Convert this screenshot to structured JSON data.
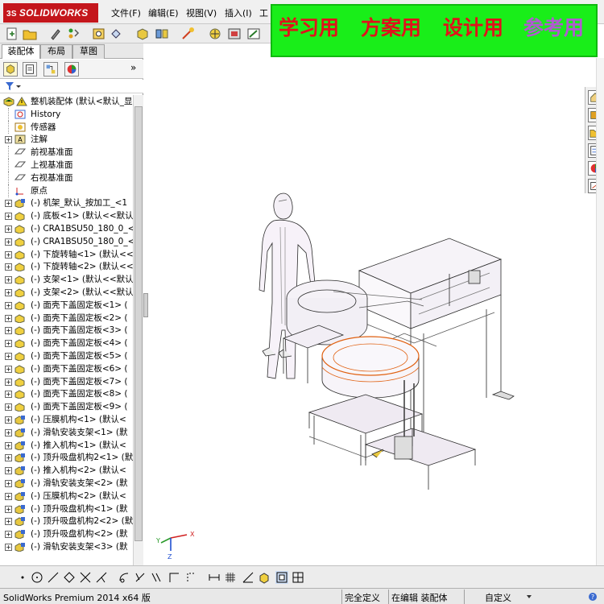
{
  "app": {
    "logo_text": "SOLIDWORKS",
    "logo_prefix": "3S"
  },
  "menu": {
    "items": [
      "文件(F)",
      "编辑(E)",
      "视图(V)",
      "插入(I)",
      "工"
    ]
  },
  "banner": {
    "words": [
      {
        "text": "学习用",
        "color": "#e0121b"
      },
      {
        "text": "方案用",
        "color": "#e0121b"
      },
      {
        "text": "设计用",
        "color": "#e0121b"
      },
      {
        "text": "参考用",
        "color": "#b05ad0"
      }
    ]
  },
  "panel": {
    "tabs": [
      "装配体",
      "布局",
      "草图"
    ],
    "active_tab": 0
  },
  "tree": {
    "root": "整机装配体 (默认<默认_显",
    "items": [
      {
        "label": "History",
        "icon": "history-icon",
        "expand": false
      },
      {
        "label": "传感器",
        "icon": "sensor-icon",
        "expand": false
      },
      {
        "label": "注解",
        "icon": "annotation-icon",
        "expand": true
      },
      {
        "label": "前视基准面",
        "icon": "plane-icon",
        "expand": false
      },
      {
        "label": "上视基准面",
        "icon": "plane-icon",
        "expand": false
      },
      {
        "label": "右视基准面",
        "icon": "plane-icon",
        "expand": false
      },
      {
        "label": "原点",
        "icon": "origin-icon",
        "expand": false
      },
      {
        "label": "(-) 机架_默认_按加工_<1",
        "icon": "subassembly-icon",
        "expand": true
      },
      {
        "label": "(-) 底板<1> (默认<<默认",
        "icon": "part-icon",
        "expand": true
      },
      {
        "label": "(-) CRA1BSU50_180_0_<1>",
        "icon": "part-icon",
        "expand": true
      },
      {
        "label": "(-) CRA1BSU50_180_0_<2>",
        "icon": "part-icon",
        "expand": true
      },
      {
        "label": "(-) 下旋转轴<1> (默认<<",
        "icon": "part-icon",
        "expand": true
      },
      {
        "label": "(-) 下旋转轴<2> (默认<<",
        "icon": "part-icon",
        "expand": true
      },
      {
        "label": "(-) 支架<1> (默认<<默认",
        "icon": "part-icon",
        "expand": true
      },
      {
        "label": "(-) 支架<2> (默认<<默认",
        "icon": "part-icon",
        "expand": true
      },
      {
        "label": "(-) 面壳下盖固定板<1> (",
        "icon": "part-icon",
        "expand": true
      },
      {
        "label": "(-) 面壳下盖固定板<2> (",
        "icon": "part-icon",
        "expand": true
      },
      {
        "label": "(-) 面壳下盖固定板<3> (",
        "icon": "part-icon",
        "expand": true
      },
      {
        "label": "(-) 面壳下盖固定板<4> (",
        "icon": "part-icon",
        "expand": true
      },
      {
        "label": "(-) 面壳下盖固定板<5> (",
        "icon": "part-icon",
        "expand": true
      },
      {
        "label": "(-) 面壳下盖固定板<6> (",
        "icon": "part-icon",
        "expand": true
      },
      {
        "label": "(-) 面壳下盖固定板<7> (",
        "icon": "part-icon",
        "expand": true
      },
      {
        "label": "(-) 面壳下盖固定板<8> (",
        "icon": "part-icon",
        "expand": true
      },
      {
        "label": "(-) 面壳下盖固定板<9> (",
        "icon": "part-icon",
        "expand": true
      },
      {
        "label": "(-) 压膜机构<1> (默认<",
        "icon": "subassembly-icon",
        "expand": true
      },
      {
        "label": "(-) 滑轨安装支架<1> (默",
        "icon": "subassembly-icon",
        "expand": true
      },
      {
        "label": "(-) 推入机构<1> (默认<",
        "icon": "subassembly-icon",
        "expand": true
      },
      {
        "label": "(-) 顶升吸盘机构2<1> (默",
        "icon": "subassembly-icon",
        "expand": true
      },
      {
        "label": "(-) 推入机构<2> (默认<",
        "icon": "subassembly-icon",
        "expand": true
      },
      {
        "label": "(-) 滑轨安装支架<2> (默",
        "icon": "subassembly-icon",
        "expand": true
      },
      {
        "label": "(-) 压膜机构<2> (默认<",
        "icon": "subassembly-icon",
        "expand": true
      },
      {
        "label": "(-) 顶升吸盘机构<1> (默",
        "icon": "subassembly-icon",
        "expand": true
      },
      {
        "label": "(-) 顶升吸盘机构2<2> (默",
        "icon": "subassembly-icon",
        "expand": true
      },
      {
        "label": "(-) 顶升吸盘机构<2> (默",
        "icon": "subassembly-icon",
        "expand": true
      },
      {
        "label": "(-) 滑轨安装支架<3> (默",
        "icon": "subassembly-icon",
        "expand": true
      }
    ]
  },
  "triad": {
    "x": "X",
    "y": "Y",
    "z": "Z"
  },
  "status": {
    "product": "SolidWorks Premium 2014 x64 版",
    "fully_defined": "完全定义",
    "editing": "在编辑 装配体",
    "custom": "自定义"
  }
}
